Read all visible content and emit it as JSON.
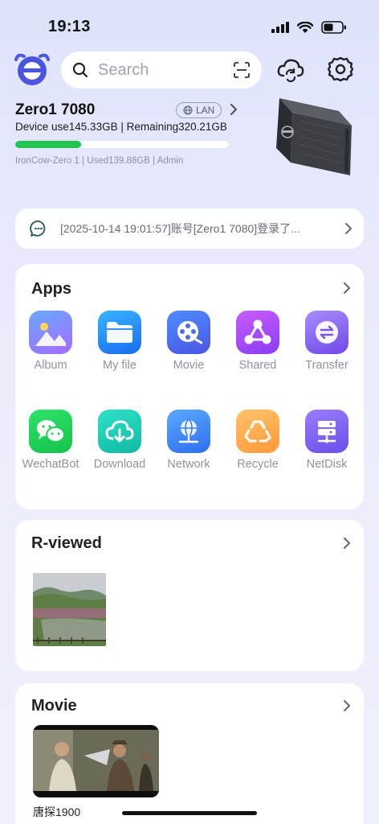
{
  "status": {
    "time": "19:13"
  },
  "header": {
    "search_placeholder": "Search"
  },
  "device": {
    "name": "Zero1 7080",
    "connection": "LAN",
    "usage": "Device use145.33GB | Remaining320.21GB",
    "usage_fraction": 0.31,
    "meta": "IronCow-Zero 1 | Used139.88GB | Admin"
  },
  "notice": {
    "text": "[2025-10-14 19:01:57]账号[Zero1 7080]登录了..."
  },
  "apps": {
    "title": "Apps",
    "items": [
      {
        "label": "Album",
        "icon": "album-icon"
      },
      {
        "label": "My file",
        "icon": "folder-icon"
      },
      {
        "label": "Movie",
        "icon": "film-reel-icon"
      },
      {
        "label": "Shared",
        "icon": "share-nodes-icon"
      },
      {
        "label": "Transfer",
        "icon": "transfer-icon"
      },
      {
        "label": "WechatBot",
        "icon": "wechat-icon"
      },
      {
        "label": "Download",
        "icon": "cloud-download-icon"
      },
      {
        "label": "Network",
        "icon": "network-globe-icon"
      },
      {
        "label": "Recycle",
        "icon": "recycle-icon"
      },
      {
        "label": "NetDisk",
        "icon": "server-icon"
      }
    ]
  },
  "recent": {
    "title": "R-viewed"
  },
  "movie": {
    "title": "Movie",
    "item_label": "唐探1900"
  },
  "colors": {
    "accent_blue": "#4a56e2",
    "progress_green": "#22c552",
    "text_secondary": "#8f93a0"
  }
}
